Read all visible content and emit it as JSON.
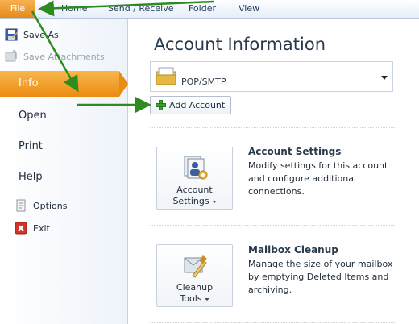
{
  "ribbon": {
    "tabs": [
      {
        "label": "File"
      },
      {
        "label": "Home"
      },
      {
        "label": "Send / Receive"
      },
      {
        "label": "Folder"
      },
      {
        "label": "View"
      }
    ]
  },
  "nav": {
    "save_as": "Save As",
    "save_attachments": "Save Attachments",
    "info": "Info",
    "open": "Open",
    "print": "Print",
    "help": "Help",
    "options": "Options",
    "exit": "Exit"
  },
  "main": {
    "title": "Account Information",
    "account_type": "POP/SMTP",
    "add_account": "Add Account",
    "account_settings": {
      "button_line1": "Account",
      "button_line2": "Settings",
      "title": "Account Settings",
      "description": "Modify settings for this account and configure additional connections."
    },
    "mailbox_cleanup": {
      "button_line1": "Cleanup",
      "button_line2": "Tools",
      "title": "Mailbox Cleanup",
      "description": "Manage the size of your mailbox by emptying Deleted Items and archiving."
    }
  },
  "icons": {
    "file_tab": "orange",
    "annotation_arrows": "arrow-icon",
    "account_icon": "mail-folder-icon"
  },
  "colors": {
    "accent_orange": "#eb8c12",
    "annotation_green": "#2e8b1f",
    "ribbon_blue": "#e7eef8"
  }
}
